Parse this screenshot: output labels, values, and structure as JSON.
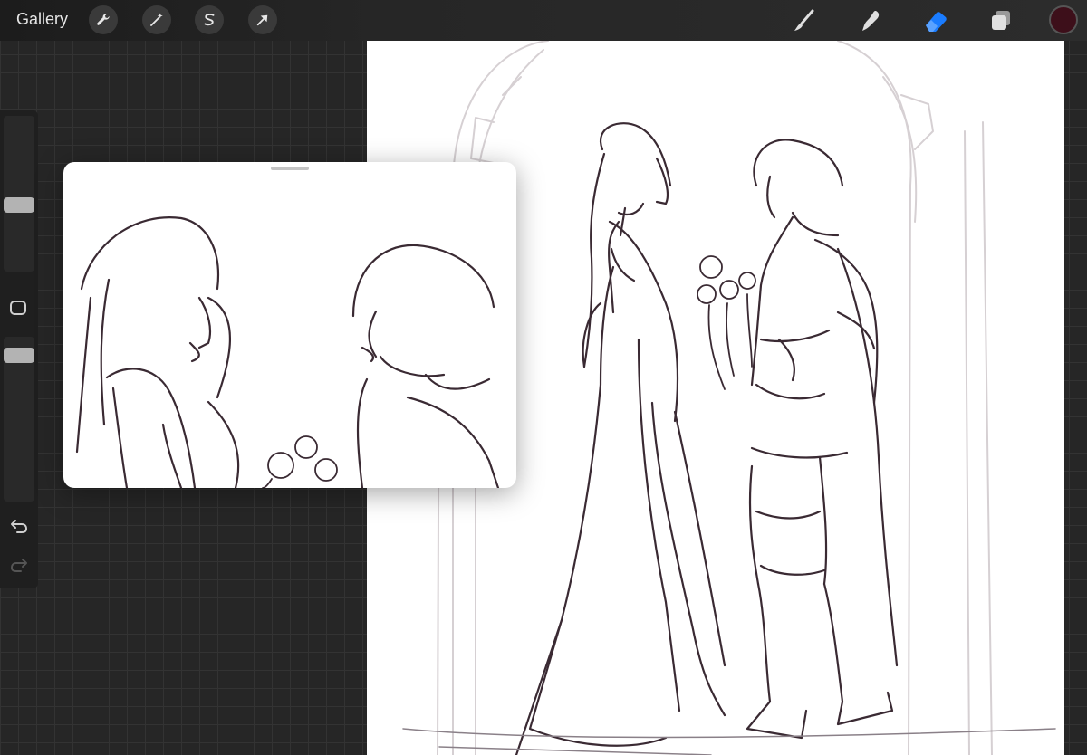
{
  "topbar": {
    "gallery_label": "Gallery",
    "left_tools": [
      {
        "name": "actions",
        "icon": "wrench-icon"
      },
      {
        "name": "adjustments",
        "icon": "magic-wand-icon"
      },
      {
        "name": "selection",
        "icon": "selection-s-icon"
      },
      {
        "name": "transform",
        "icon": "arrow-cursor-icon"
      }
    ],
    "right_tools": [
      {
        "name": "brush",
        "icon": "brush-icon",
        "active": false
      },
      {
        "name": "smudge",
        "icon": "smudge-finger-icon",
        "active": false
      },
      {
        "name": "eraser",
        "icon": "eraser-icon",
        "active": true
      },
      {
        "name": "layers",
        "icon": "layers-icon",
        "active": false
      }
    ],
    "current_color": "#3d0f1a",
    "active_tool_color": "#1a7cff"
  },
  "sidebar": {
    "brush_size_slider": {
      "icon": "slider-handle"
    },
    "modifier_button": {
      "icon": "square-modifier-icon"
    },
    "opacity_slider": {
      "icon": "slider-handle"
    },
    "undo_icon": "undo-icon",
    "redo_icon": "redo-icon"
  },
  "canvas": {
    "content": "line-art-sketch",
    "stroke_color": "#3a2a33",
    "background": "#ffffff"
  },
  "reference_window": {
    "content": "zoomed-reference-sketch"
  }
}
